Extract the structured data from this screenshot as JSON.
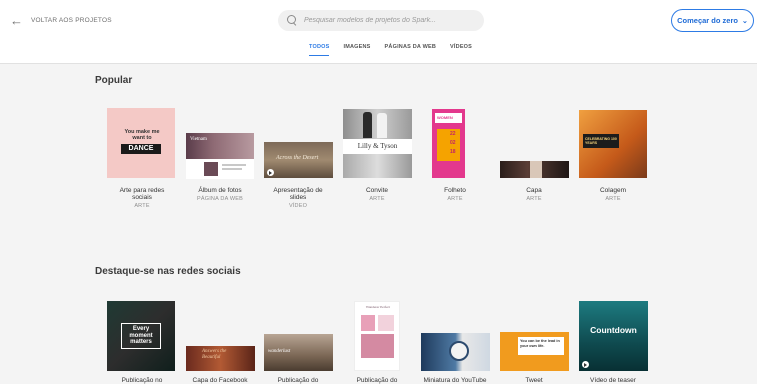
{
  "header": {
    "back_label": "VOLTAR AOS PROJETOS",
    "search_placeholder": "Pesquisar modelos de projetos do Spark...",
    "start_button": "Começar do zero"
  },
  "tabs": [
    {
      "label": "TODOS",
      "active": true
    },
    {
      "label": "IMAGENS",
      "active": false
    },
    {
      "label": "PÁGINAS DA WEB",
      "active": false
    },
    {
      "label": "VÍDEOS",
      "active": false
    }
  ],
  "sections": {
    "popular": {
      "title": "Popular",
      "items": [
        {
          "name": "Arte para redes sociais",
          "category": "ARTE",
          "thumb_text": "You make me want to",
          "thumb_text2": "DANCE"
        },
        {
          "name": "Álbum de fotos",
          "category": "PÁGINA DA WEB",
          "thumb_text": "Vietnam"
        },
        {
          "name": "Apresentação de slides",
          "category": "VÍDEO",
          "thumb_text": "Across the Desert"
        },
        {
          "name": "Convite",
          "category": "ARTE",
          "thumb_text": "Lilly & Tyson"
        },
        {
          "name": "Folheto",
          "category": "ARTE",
          "thumb_text": "WOMEN",
          "thumb_dates": [
            "22",
            "02",
            "18"
          ]
        },
        {
          "name": "Capa",
          "category": "ARTE"
        },
        {
          "name": "Colagem",
          "category": "ARTE",
          "thumb_text": "CELEBRATING 100 YEARS"
        }
      ]
    },
    "social": {
      "title": "Destaque-se nas redes sociais",
      "items": [
        {
          "name": "Publicação no",
          "thumb_text": "Every moment matters"
        },
        {
          "name": "Capa do Facebook",
          "thumb_text": "Answers the Beautiful"
        },
        {
          "name": "Publicação do",
          "thumb_text": "wanderlust"
        },
        {
          "name": "Publicação do",
          "thumb_text": "Wanderer Perfect"
        },
        {
          "name": "Miniatura do YouTube"
        },
        {
          "name": "Tweet",
          "thumb_text": "You can be the lead in your own life."
        },
        {
          "name": "Vídeo de teaser",
          "thumb_text": "Countdown"
        }
      ]
    }
  },
  "colors": {
    "accent": "#2d7be5",
    "page_bg": "#f4f4f4"
  }
}
